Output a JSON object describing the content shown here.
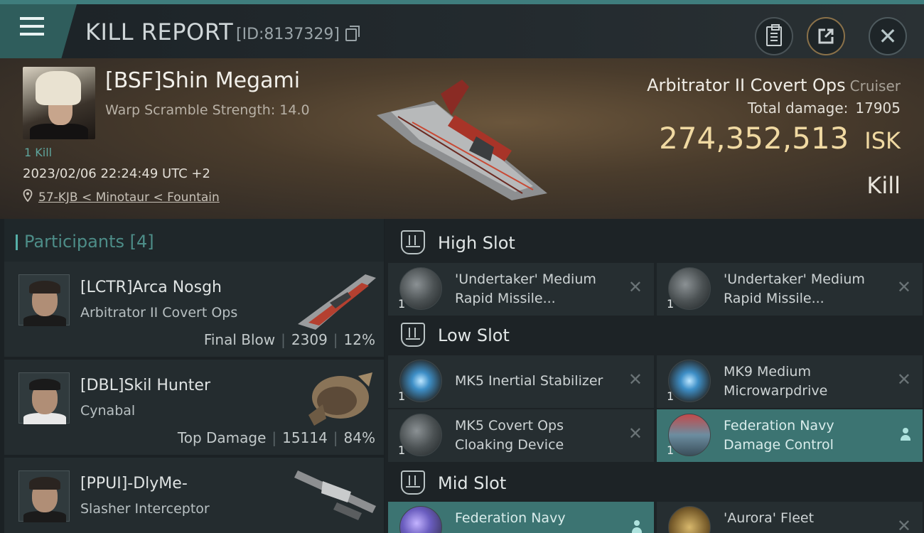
{
  "header": {
    "title": "KILL REPORT",
    "report_id": "[ID:8137329]"
  },
  "victim": {
    "pilot": "[BSF]Shin Megami",
    "scram": "Warp Scramble Strength: 14.0",
    "kills": "1 Kill",
    "datetime": "2023/02/06 22:24:49 UTC +2",
    "location": "57-KJB < Minotaur < Fountain",
    "ship": "Arbitrator II Covert Ops",
    "ship_class": "Cruiser",
    "total_damage_label": "Total damage:",
    "total_damage": "17905",
    "isk_value": "274,352,513",
    "isk_unit": "ISK",
    "result": "Kill"
  },
  "participants": {
    "title": "Participants [4]",
    "rows": [
      {
        "name": "[LCTR]Arca Nosgh",
        "ship": "Arbitrator II Covert Ops",
        "tag": "Final Blow",
        "damage": "2309",
        "pct": "12%"
      },
      {
        "name": "[DBL]Skil Hunter",
        "ship": "Cynabal",
        "tag": "Top Damage",
        "damage": "15114",
        "pct": "84%"
      },
      {
        "name": "[PPUI]-DlyMe-",
        "ship": "Slasher Interceptor"
      }
    ]
  },
  "modules": {
    "high_slot": "High Slot",
    "low_slot": "Low Slot",
    "mid_slot": "Mid Slot",
    "high": [
      {
        "name": "'Undertaker' Medium Rapid Missile...",
        "qty": "1"
      },
      {
        "name": "'Undertaker' Medium Rapid Missile...",
        "qty": "1"
      }
    ],
    "low": [
      {
        "name": "MK5 Inertial Stabilizer",
        "qty": "1"
      },
      {
        "name": "MK9 Medium Microwarpdrive",
        "qty": "1"
      },
      {
        "name": "MK5 Covert Ops Cloaking Device",
        "qty": "1"
      },
      {
        "name": "Federation Navy Damage Control",
        "qty": "1"
      }
    ],
    "mid": [
      {
        "name": "Federation Navy"
      },
      {
        "name": "'Aurora' Fleet"
      }
    ]
  },
  "colors": {
    "accent": "#3f7d7d",
    "isk": "#f0d9a2",
    "active_module": "#3c7472"
  }
}
